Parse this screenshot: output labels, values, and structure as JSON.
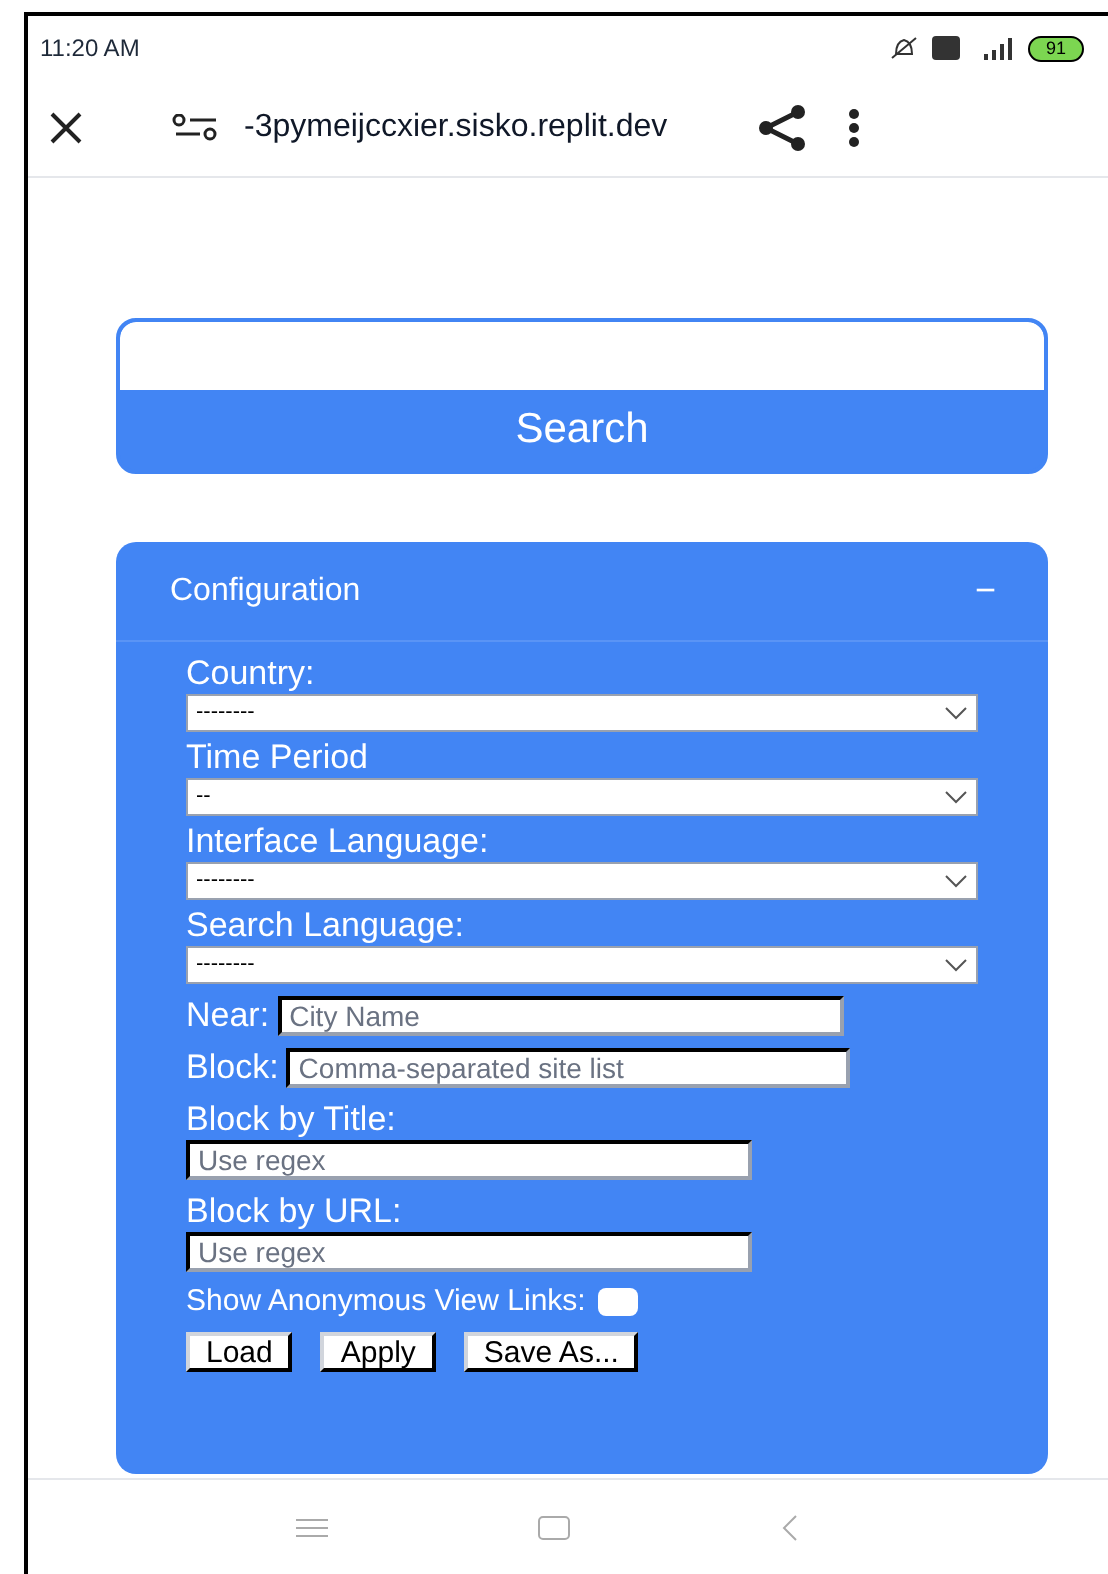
{
  "status_bar": {
    "time": "11:20 AM",
    "battery": "91"
  },
  "address_bar": {
    "url": "-3pymeijccxier.sisko.replit.dev"
  },
  "search": {
    "button": "Search"
  },
  "configuration": {
    "title": "Configuration",
    "toggle": "−",
    "expanded": true,
    "fields": [
      {
        "kind": "select",
        "label": "Country:",
        "value": "--------"
      },
      {
        "kind": "select",
        "label": "Time Period",
        "value": "--"
      },
      {
        "kind": "select",
        "label": "Interface Language:",
        "value": "--------"
      },
      {
        "kind": "select",
        "label": "Search Language:",
        "value": "--------"
      },
      {
        "kind": "inline",
        "label": "Near:",
        "placeholder": "City Name"
      },
      {
        "kind": "inline",
        "label": "Block:",
        "placeholder": "Comma-separated site list"
      },
      {
        "kind": "text",
        "label": "Block by Title:",
        "placeholder": "Use regex"
      },
      {
        "kind": "text",
        "label": "Block by URL:",
        "placeholder": "Use regex"
      },
      {
        "kind": "checkbox",
        "label": "Show Anonymous View Links:",
        "checked": false
      }
    ],
    "buttons": [
      "Load",
      "Apply",
      "Save As..."
    ]
  }
}
